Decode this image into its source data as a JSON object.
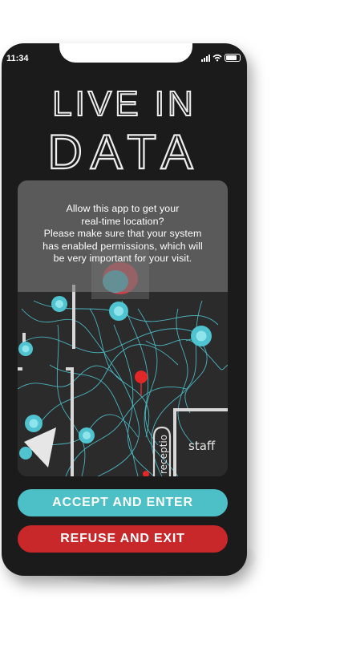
{
  "status_bar": {
    "time": "11:34"
  },
  "app_logo": {
    "line1": "LIVE IN",
    "line2": "DATA"
  },
  "permission_prompt": {
    "message": "Allow this app to get your\nreal-time location?\nPlease make sure that your system\nhas enabled permissions, which will\nbe very important for your visit."
  },
  "map": {
    "staff_label": "staff",
    "reception_label": "receptio"
  },
  "buttons": {
    "accept_label": "ACCEPT AND ENTER",
    "refuse_label": "REFUSE AND EXIT"
  },
  "colors": {
    "accent": "#4cc0c6",
    "danger": "#c8282a",
    "phone_body": "#1b1b1b"
  }
}
